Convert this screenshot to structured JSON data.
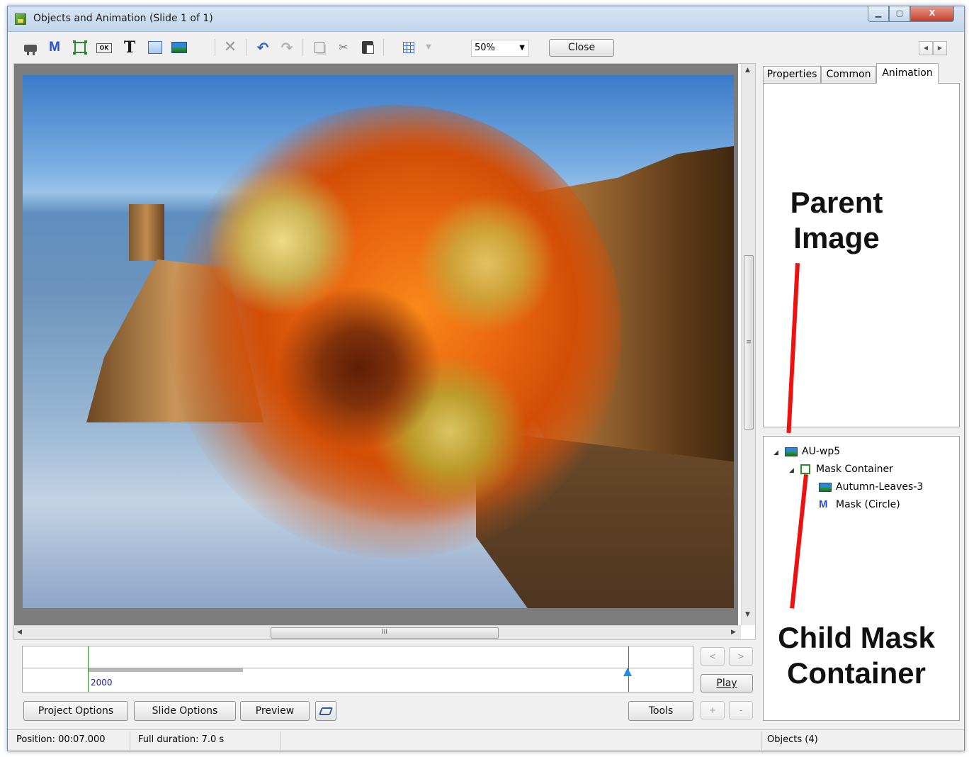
{
  "window": {
    "title": "Objects and Animation  (Slide 1 of 1)",
    "minimize_label": "▁",
    "maximize_label": "▢",
    "close_label": "X"
  },
  "toolbar": {
    "icons": [
      "camera-icon",
      "mask-icon",
      "frame-icon",
      "button-icon",
      "text-icon",
      "rectangle-icon",
      "image-icon",
      "delete-icon",
      "undo-icon",
      "redo-icon",
      "copy-icon",
      "cut-icon",
      "paste-icon",
      "grid-icon"
    ],
    "mask_label": "M",
    "text_label": "T",
    "ok_label": "OK",
    "zoom_value": "50%",
    "close_button": "Close"
  },
  "tabs": {
    "properties": "Properties",
    "common": "Common",
    "animation": "Animation"
  },
  "tree": {
    "items": [
      {
        "label": "AU-wp5",
        "type": "image",
        "expanded": true
      },
      {
        "label": "Mask Container",
        "type": "frame",
        "expanded": true
      },
      {
        "label": "Autumn-Leaves-3",
        "type": "image"
      },
      {
        "label": "Mask (Circle)",
        "type": "mask"
      }
    ]
  },
  "annotations": {
    "parent": "Parent Image",
    "child": "Child Mask Container",
    "arrow_color": "#ee1111"
  },
  "timeline": {
    "marker_label": "2000",
    "prev": "<",
    "next": ">",
    "play": "Play",
    "add": "+",
    "remove": "-"
  },
  "buttons": {
    "project_options": "Project Options",
    "slide_options": "Slide Options",
    "preview": "Preview",
    "tools": "Tools"
  },
  "status": {
    "position": "Position: 00:07.000",
    "duration": "Full duration:  7.0 s",
    "objects": "Objects (4)"
  },
  "scrollbar": {
    "grip": "III",
    "grip_v": "≡"
  }
}
